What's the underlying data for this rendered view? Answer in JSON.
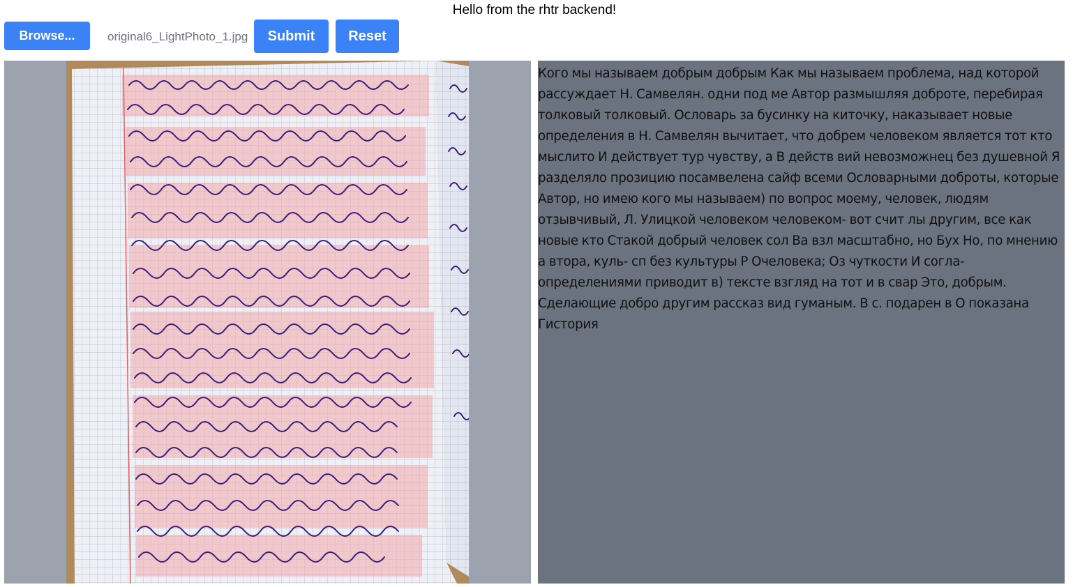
{
  "header": {
    "title": "Hello from the rhtr backend!"
  },
  "toolbar": {
    "browse_label": "Browse...",
    "file_name": "original6_LightPhoto_1.jpg",
    "submit_label": "Submit",
    "reset_label": "Reset"
  },
  "colors": {
    "button": "#3b82f6",
    "image_panel_bg": "#9ca3af",
    "text_panel_bg": "#6b7280",
    "ink": "#3a1e7a",
    "highlight": "#f4a9a9"
  },
  "photo": {
    "icon": "handwritten-notebook-page"
  },
  "result": {
    "text": "Кого мы называем добрым добрым Как мы называем проблема, над которой рассуждает Н. Самвелян. одни под ме Автор размышляя доброте, перебирая толковый толковый. Ословарь за бусинку на киточку, наказывает новые определения в Н. Самвелян вычитает, что добрем человеком является тот кто мыслито И действует тур чувству, а В действ вий невозможнец без душевной Я разделяло прозицию посамвелена сайф всеми Ословарными доброты, которые Автор, но имею кого мы называем) по вопрос моему, человек, людям отзывчивый, Л. Улицкой человеком человеком- вот счит лы другим, все как новые кто Стакой добрый человек сол Ва взл масштабно, но Бух Но, по мнению а втора, куль- сп без культуры Р Очеловека; Оз чуткости И согла- определениями приводит в) тексте взгляд на тот и в свар Это, добрым. Сделающие добро другим рассказ вид гуманым. В с. подарен в О показана Гистория"
  }
}
